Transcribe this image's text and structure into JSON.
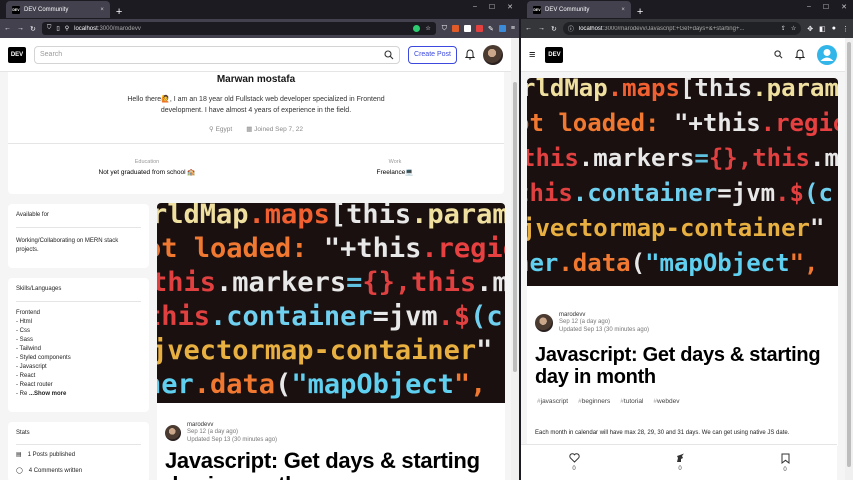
{
  "left": {
    "tab": {
      "title": "DEV Community",
      "close": "×"
    },
    "new_tab": "+",
    "url": {
      "host": "localhost",
      "path": ":3000/marodevv"
    },
    "header": {
      "logo": "DEV",
      "search_placeholder": "Search",
      "create_post": "Create Post"
    },
    "profile": {
      "name": "Marwan mostafa",
      "bio": "Hello there🙋, I am an 18 year old Fullstack web developer specialized in Frontend development. I have almost 4 years of experience in the field.",
      "location": "Egypt",
      "joined": "Joined Sep 7, 22",
      "education_label": "Education",
      "education_value": "Not yet graduated from school 🏫",
      "work_label": "Work",
      "work_value": "Freelance💻"
    },
    "available": {
      "title": "Available for",
      "text": "Working/Collaborating on MERN stack projects."
    },
    "skills": {
      "title": "Skills/Languages",
      "lines": [
        "Frontend",
        "- Html",
        "- Css",
        "- Sass",
        "- Tailwind",
        "- Styled components",
        "- Javascript",
        "- React",
        "- React router",
        "- Re"
      ],
      "show_more": "...Show more"
    },
    "stats": {
      "title": "Stats",
      "posts": "1 Posts published",
      "comments": "4 Comments written"
    },
    "article": {
      "author": "marodevv",
      "date": "Sep 12 (a day ago)",
      "updated": "Updated Sep 13 (30 minutes ago)",
      "title": "Javascript: Get days & starting day in month"
    }
  },
  "right": {
    "tab": {
      "title": "DEV Community",
      "close": "×"
    },
    "new_tab": "+",
    "url": {
      "host": "localhost",
      "path": ":3000/marodevv/Javascript:+Get+days+&+starting+..."
    },
    "header": {
      "logo": "DEV"
    },
    "article": {
      "author": "marodevv",
      "date": "Sep 12 (a day ago)",
      "updated": "Updated Sep 13 (30 minutes ago)",
      "title": "Javascript: Get days & starting day in month",
      "tags": [
        "javascript",
        "beginners",
        "tutorial",
        "webdev"
      ],
      "body": "Each month in calendar will have max 28, 29, 30 and 31 days. We can get using native JS date."
    },
    "reactions": {
      "likes": "0",
      "unicorns": "0",
      "saves": "0"
    }
  },
  "cover_code": [
    "rldMap.maps[this.param",
    "ot loaded: \"+this.regions",
    "this.markers={},this.m",
    "this.container=jvm.$(c",
    "jvectormap-container\"",
    "ner.data(\"mapObject\","
  ],
  "colors": {
    "accent": "#3b49df",
    "chrome_dark": "#1c1b22",
    "chrome": "#42414d"
  }
}
